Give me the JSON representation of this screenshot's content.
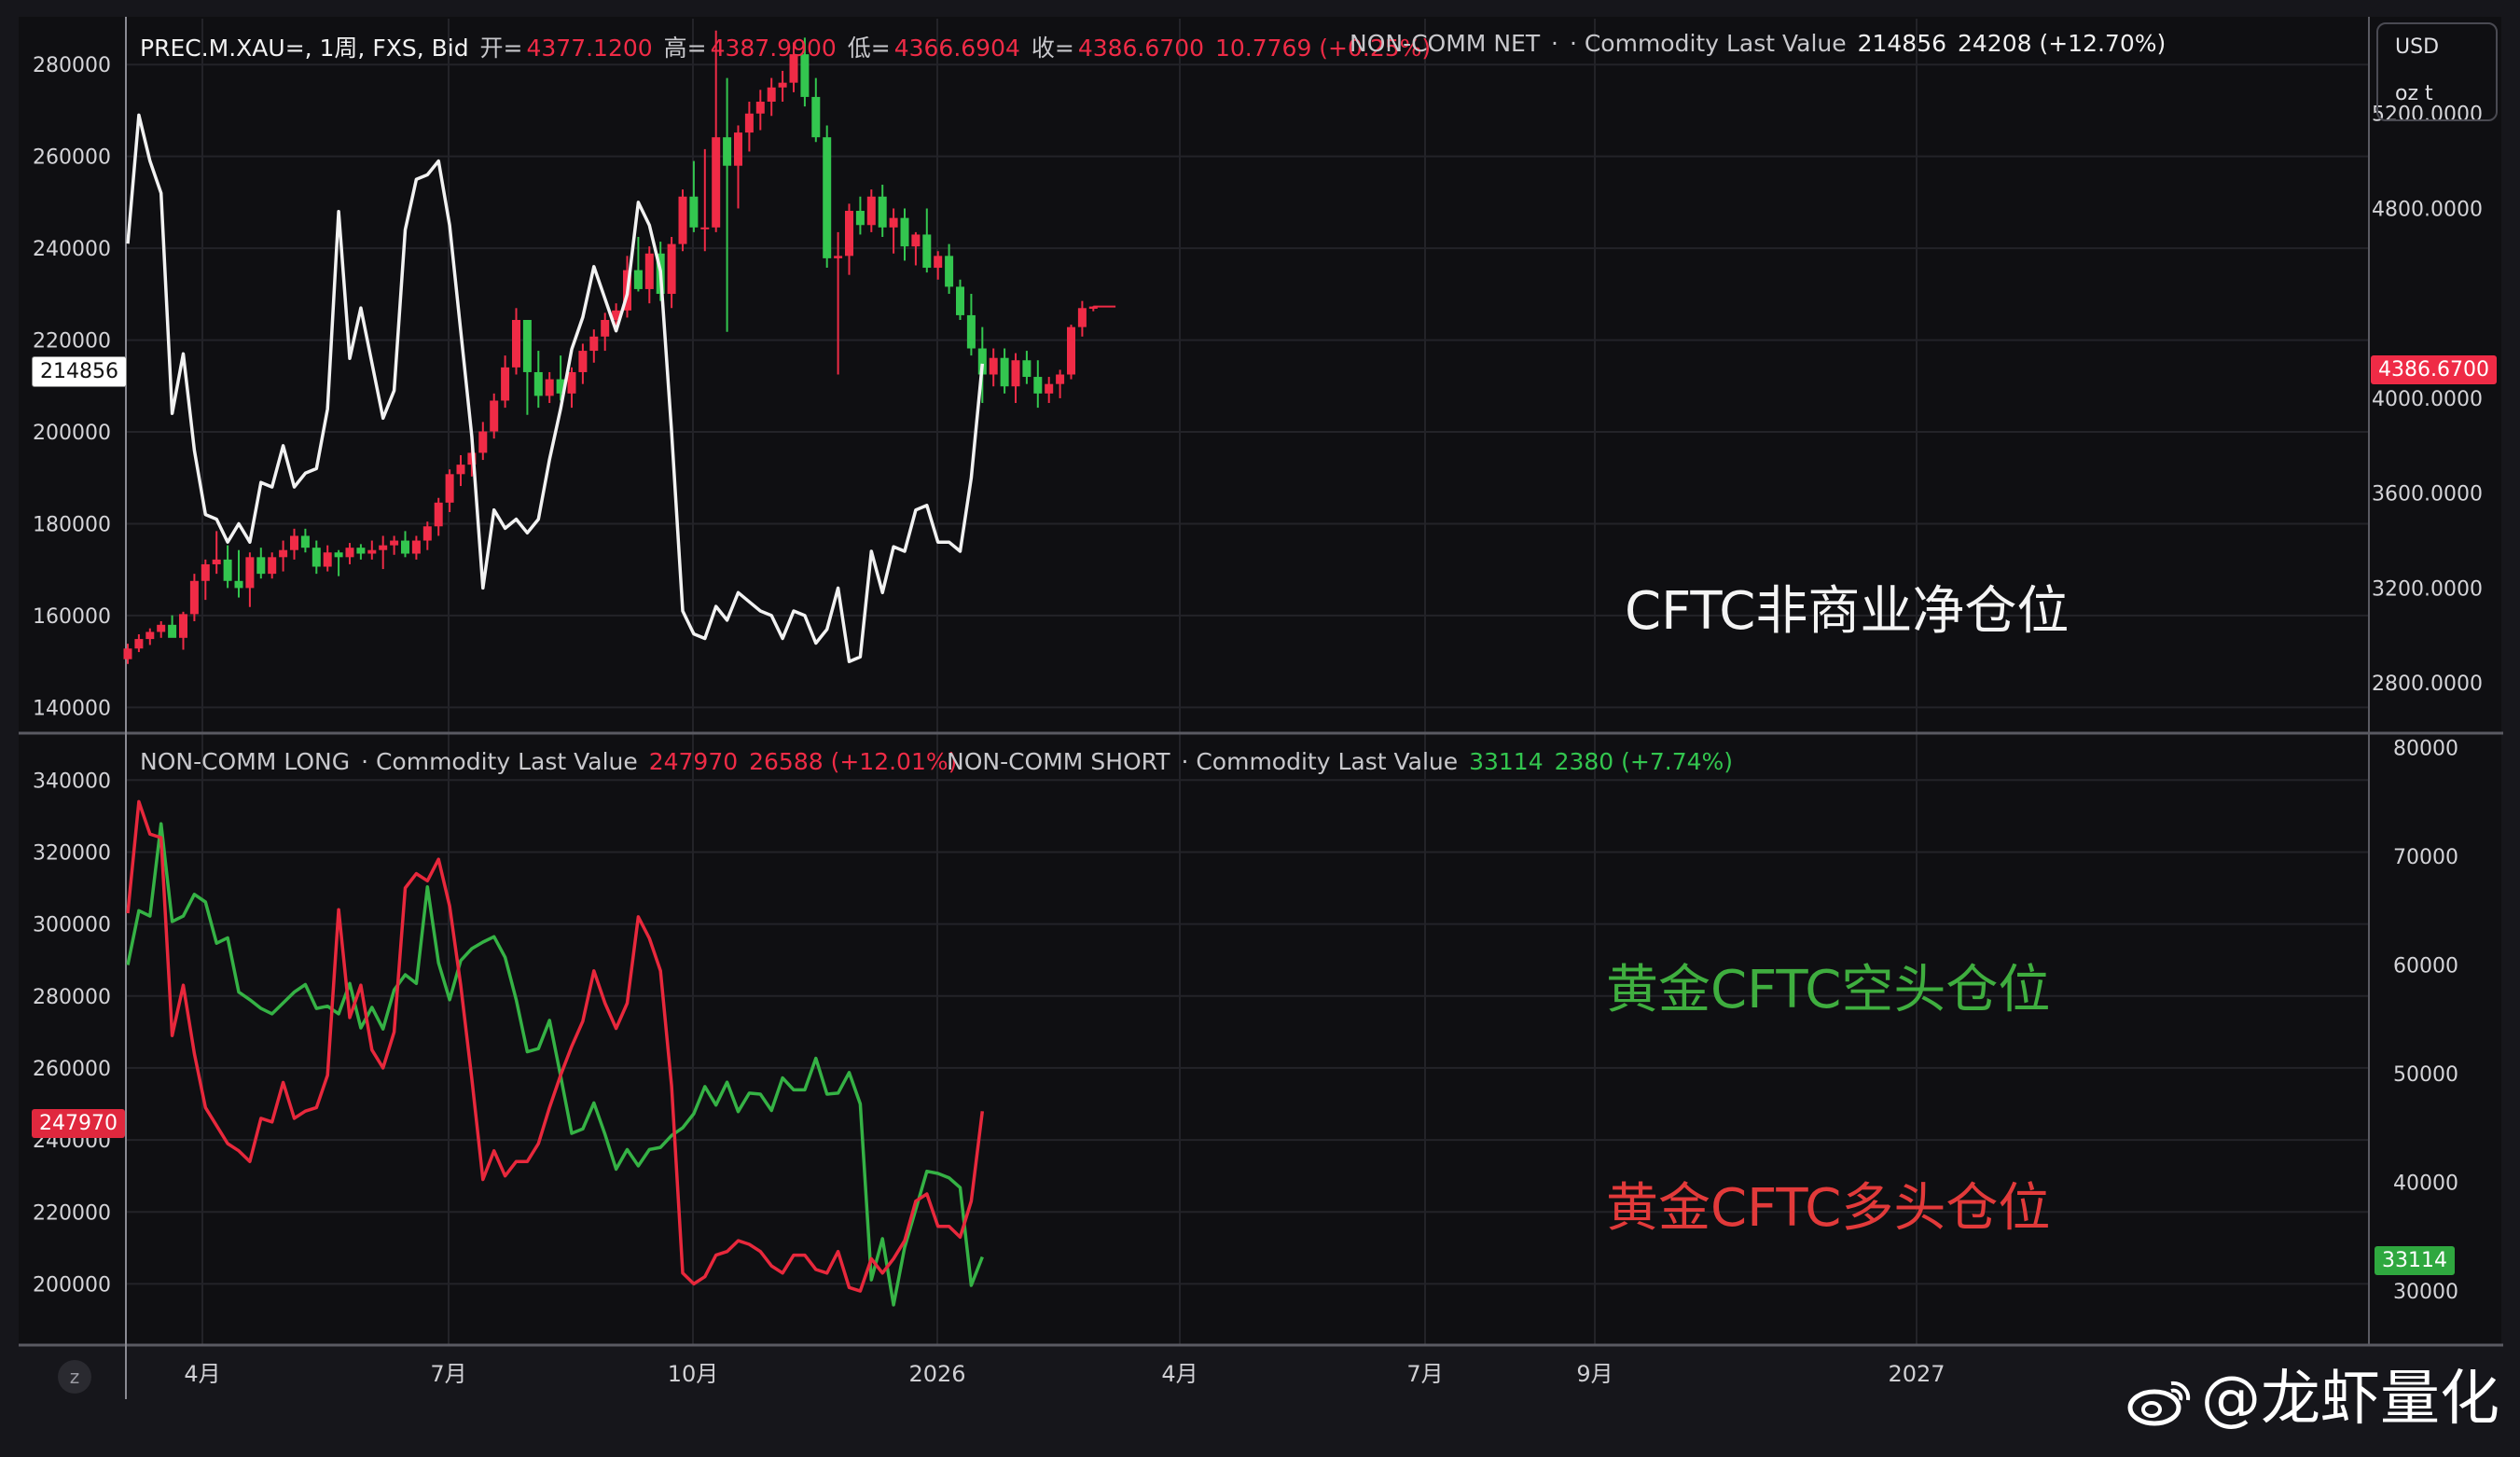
{
  "legends": {
    "top_main": {
      "symbol": "PREC.M.XAU=, 1周, FXS, Bid",
      "open_label": "开=",
      "open": "4377.1200",
      "high_label": "高=",
      "high": "4387.9900",
      "low_label": "低=",
      "low": "4366.6904",
      "close_label": "收=",
      "close": "4386.6700",
      "change": "10.7769 (+0.25%)"
    },
    "top_net": {
      "name": "NON-COMM NET",
      "sep": "·",
      "source": "· Commodity Last Value",
      "value": "214856",
      "change": "24208 (+12.70%)"
    },
    "bottom_long": {
      "name": "NON-COMM LONG",
      "source": "· Commodity Last Value",
      "value": "247970",
      "change": "26588 (+12.01%)"
    },
    "bottom_short": {
      "name": "NON-COMM SHORT",
      "source": "· Commodity Last Value",
      "value": "33114",
      "change": "2380 (+7.74%)"
    }
  },
  "annotations": {
    "net": "CFTC非商业净仓位",
    "short": "黄金CFTC空头仓位",
    "long": "黄金CFTC多头仓位"
  },
  "unit_box": {
    "currency": "USD",
    "unit": "oz t"
  },
  "price_tags": {
    "net_last": "214856",
    "gold_last": "4386.6700",
    "long_last": "247970",
    "short_last": "33114"
  },
  "zoom_icon": "z",
  "watermark": "@龙虾量化",
  "watermark_icon": "weibo-logo-icon",
  "colors": {
    "background": "#16161b",
    "plot_bg": "#0f0f12",
    "up": "#ef2b46",
    "down": "#33c64f",
    "net_line": "#f2f2f2",
    "long_line": "#e8283c",
    "short_line": "#35b245"
  },
  "chart_data": [
    {
      "type": "candlestick+line",
      "panel": "top",
      "grid": true,
      "x_ticks": [
        "4月",
        "7月",
        "10月",
        "2026",
        "4月",
        "7月",
        "9月",
        "2027"
      ],
      "left_axis": {
        "ticks": [
          280000,
          260000,
          240000,
          220000,
          200000,
          180000,
          160000,
          140000
        ],
        "range": [
          135000,
          290000
        ]
      },
      "right_axis": {
        "ticks": [
          "5200.0000",
          "4800.0000",
          "4000.0000",
          "3600.0000",
          "3200.0000",
          "2800.0000"
        ],
        "range": [
          2600,
          5600
        ]
      },
      "gold_weekly_ohlc": [
        [
          2900,
          2965,
          2880,
          2945
        ],
        [
          2945,
          3005,
          2930,
          2985
        ],
        [
          2985,
          3030,
          2960,
          3015
        ],
        [
          3015,
          3060,
          2990,
          3045
        ],
        [
          3045,
          3085,
          3010,
          2990
        ],
        [
          2990,
          3100,
          2940,
          3090
        ],
        [
          3090,
          3260,
          3060,
          3230
        ],
        [
          3230,
          3320,
          3150,
          3300
        ],
        [
          3300,
          3440,
          3260,
          3320
        ],
        [
          3320,
          3380,
          3200,
          3230
        ],
        [
          3230,
          3360,
          3160,
          3200
        ],
        [
          3200,
          3350,
          3120,
          3330
        ],
        [
          3330,
          3370,
          3240,
          3260
        ],
        [
          3260,
          3350,
          3240,
          3330
        ],
        [
          3330,
          3400,
          3270,
          3360
        ],
        [
          3360,
          3450,
          3320,
          3420
        ],
        [
          3420,
          3450,
          3350,
          3370
        ],
        [
          3370,
          3400,
          3260,
          3290
        ],
        [
          3290,
          3380,
          3270,
          3350
        ],
        [
          3350,
          3360,
          3250,
          3330
        ],
        [
          3330,
          3390,
          3300,
          3370
        ],
        [
          3370,
          3385,
          3320,
          3345
        ],
        [
          3345,
          3400,
          3320,
          3360
        ],
        [
          3360,
          3420,
          3280,
          3380
        ],
        [
          3380,
          3420,
          3340,
          3400
        ],
        [
          3400,
          3440,
          3330,
          3345
        ],
        [
          3345,
          3420,
          3320,
          3400
        ],
        [
          3400,
          3480,
          3360,
          3460
        ],
        [
          3460,
          3580,
          3420,
          3560
        ],
        [
          3560,
          3700,
          3520,
          3680
        ],
        [
          3680,
          3760,
          3630,
          3720
        ],
        [
          3720,
          3800,
          3670,
          3770
        ],
        [
          3770,
          3900,
          3740,
          3860
        ],
        [
          3860,
          4020,
          3830,
          3990
        ],
        [
          3990,
          4180,
          3960,
          4130
        ],
        [
          4130,
          4380,
          4100,
          4330
        ],
        [
          4330,
          4320,
          3930,
          4110
        ],
        [
          4110,
          4200,
          3960,
          4010
        ],
        [
          4010,
          4110,
          3980,
          4080
        ],
        [
          4080,
          4180,
          3990,
          4020
        ],
        [
          4020,
          4130,
          3960,
          4110
        ],
        [
          4110,
          4230,
          4060,
          4200
        ],
        [
          4200,
          4290,
          4150,
          4260
        ],
        [
          4260,
          4360,
          4200,
          4330
        ],
        [
          4330,
          4400,
          4280,
          4370
        ],
        [
          4370,
          4600,
          4340,
          4540
        ],
        [
          4540,
          4680,
          4450,
          4460
        ],
        [
          4460,
          4640,
          4400,
          4610
        ],
        [
          4610,
          4660,
          4410,
          4440
        ],
        [
          4440,
          4680,
          4380,
          4650
        ],
        [
          4650,
          4880,
          4620,
          4850
        ],
        [
          4850,
          5000,
          4700,
          4720
        ],
        [
          4720,
          5050,
          4620,
          4720
        ],
        [
          4720,
          5550,
          4700,
          5100
        ],
        [
          5100,
          5350,
          4280,
          4980
        ],
        [
          4980,
          5150,
          4800,
          5120
        ],
        [
          5120,
          5250,
          5040,
          5200
        ],
        [
          5200,
          5300,
          5130,
          5250
        ],
        [
          5250,
          5350,
          5190,
          5310
        ],
        [
          5310,
          5380,
          5250,
          5330
        ],
        [
          5330,
          5500,
          5290,
          5450
        ],
        [
          5450,
          5520,
          5230,
          5270
        ],
        [
          5270,
          5350,
          5080,
          5100
        ],
        [
          5100,
          5150,
          4550,
          4590
        ],
        [
          4590,
          4700,
          4100,
          4600
        ],
        [
          4600,
          4820,
          4520,
          4790
        ],
        [
          4790,
          4850,
          4690,
          4730
        ],
        [
          4730,
          4880,
          4700,
          4850
        ],
        [
          4850,
          4900,
          4680,
          4720
        ],
        [
          4720,
          4800,
          4610,
          4760
        ],
        [
          4760,
          4800,
          4580,
          4640
        ],
        [
          4640,
          4700,
          4560,
          4690
        ],
        [
          4690,
          4800,
          4530,
          4550
        ],
        [
          4550,
          4620,
          4500,
          4600
        ],
        [
          4600,
          4650,
          4440,
          4470
        ],
        [
          4470,
          4500,
          4330,
          4350
        ],
        [
          4350,
          4440,
          4180,
          4210
        ],
        [
          4210,
          4300,
          3980,
          4100
        ],
        [
          4100,
          4210,
          4050,
          4170
        ],
        [
          4170,
          4210,
          4020,
          4050
        ],
        [
          4050,
          4190,
          3980,
          4160
        ],
        [
          4160,
          4200,
          4060,
          4090
        ],
        [
          4090,
          4160,
          3960,
          4020
        ],
        [
          4020,
          4090,
          3980,
          4060
        ],
        [
          4060,
          4120,
          4000,
          4100
        ],
        [
          4100,
          4310,
          4080,
          4300
        ],
        [
          4300,
          4410,
          4260,
          4380
        ],
        [
          4377.12,
          4387.99,
          4366.69,
          4386.67
        ]
      ],
      "net_positions": [
        241000,
        269000,
        259000,
        252000,
        204000,
        217000,
        196000,
        182000,
        181000,
        176000,
        180000,
        176000,
        189000,
        188000,
        197000,
        188000,
        191000,
        192000,
        205000,
        248000,
        216000,
        227000,
        215000,
        203000,
        209000,
        244000,
        255000,
        256000,
        259000,
        245000,
        222000,
        199000,
        166000,
        183000,
        179000,
        181000,
        178000,
        181000,
        194000,
        205000,
        218000,
        225000,
        236000,
        229000,
        222000,
        230000,
        250000,
        245000,
        235000,
        200000,
        161000,
        156000,
        155000,
        162000,
        159000,
        165000,
        163000,
        161000,
        160000,
        155000,
        161000,
        160000,
        154000,
        157000,
        166000,
        150000,
        151000,
        174000,
        165000,
        175000,
        174000,
        183000,
        184000,
        176000,
        176000,
        174000,
        190000,
        214856
      ]
    },
    {
      "type": "line",
      "panel": "bottom",
      "grid": true,
      "left_axis": {
        "ticks": [
          340000,
          320000,
          300000,
          280000,
          260000,
          240000,
          220000,
          200000
        ],
        "range": [
          183000,
          352000
        ]
      },
      "right_axis": {
        "ticks": [
          80000,
          70000,
          60000,
          50000,
          40000,
          30000
        ],
        "range": [
          25000,
          81000
        ]
      },
      "series": [
        {
          "name": "NON-COMM LONG",
          "axis": "left",
          "values": [
            303000,
            334000,
            325000,
            324000,
            269000,
            283000,
            264000,
            249000,
            244000,
            239000,
            237000,
            234000,
            246000,
            245000,
            256000,
            246000,
            248000,
            249000,
            258000,
            304000,
            274000,
            283000,
            265000,
            260000,
            270000,
            310000,
            314000,
            312000,
            318000,
            305000,
            283000,
            257000,
            229000,
            237000,
            230000,
            234000,
            234000,
            239000,
            249000,
            258000,
            266000,
            273000,
            287000,
            278000,
            271000,
            278000,
            302000,
            296000,
            287000,
            255000,
            203000,
            200000,
            202000,
            208000,
            209000,
            212000,
            211000,
            209000,
            205000,
            203000,
            208000,
            208000,
            204000,
            203000,
            209000,
            199000,
            198000,
            207000,
            203000,
            207000,
            212000,
            223000,
            225000,
            216000,
            216000,
            213000,
            223000,
            247970
          ]
        },
        {
          "name": "NON-COMM SHORT",
          "axis": "right",
          "values": [
            60000,
            65000,
            64500,
            73000,
            64000,
            64500,
            66500,
            65800,
            62000,
            62500,
            57500,
            56800,
            56000,
            55500,
            56500,
            57500,
            58200,
            56000,
            56200,
            55500,
            58300,
            54200,
            56100,
            54100,
            57700,
            59100,
            58300,
            67200,
            60200,
            56800,
            60400,
            61500,
            62100,
            62600,
            60700,
            56800,
            52000,
            52300,
            54900,
            49800,
            44500,
            44900,
            47300,
            44400,
            41200,
            43000,
            41500,
            43000,
            43200,
            44300,
            45000,
            46300,
            48800,
            47100,
            49200,
            46500,
            48200,
            48100,
            46600,
            49600,
            48500,
            48500,
            51400,
            48100,
            48200,
            50100,
            47200,
            31000,
            34800,
            28700,
            34000,
            37500,
            41000,
            40800,
            40400,
            39500,
            30500,
            33114
          ]
        }
      ]
    }
  ]
}
